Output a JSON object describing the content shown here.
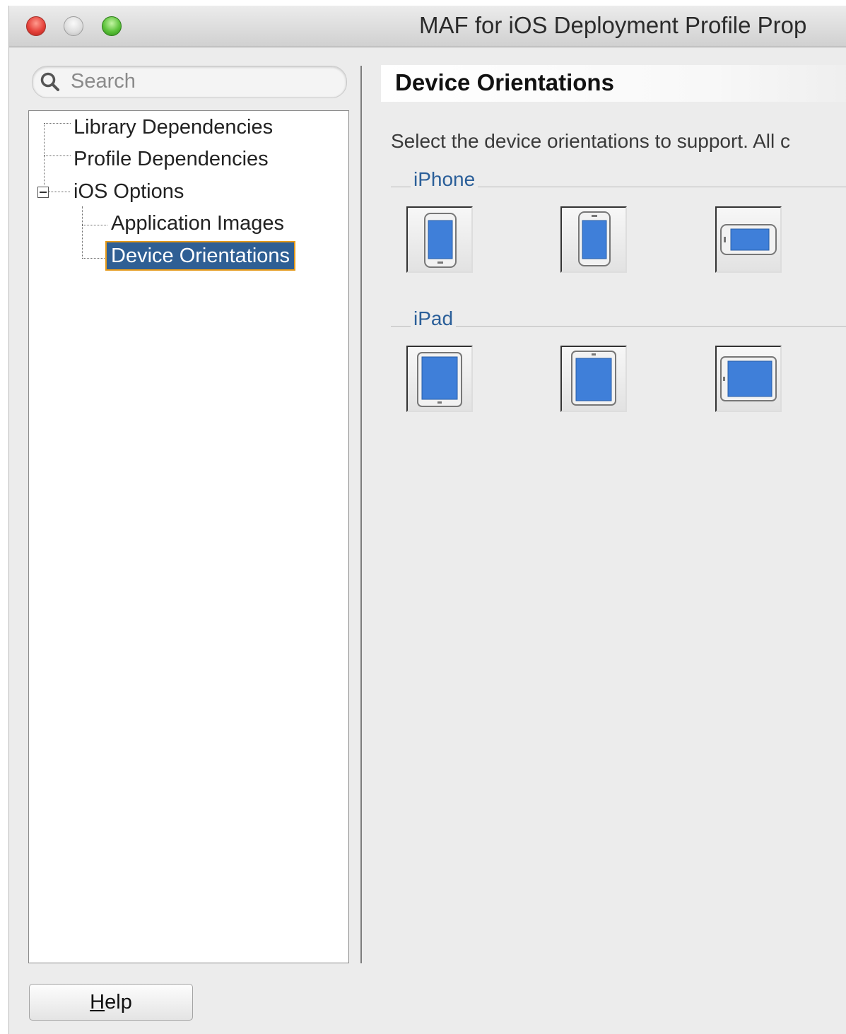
{
  "window": {
    "title": "MAF for iOS Deployment Profile Prop"
  },
  "search": {
    "placeholder": "Search"
  },
  "tree": {
    "items": [
      {
        "label": "Library Dependencies"
      },
      {
        "label": "Profile Dependencies"
      },
      {
        "label": "iOS Options"
      },
      {
        "label": "Application Images"
      },
      {
        "label": "Device Orientations"
      }
    ],
    "selected": "Device Orientations"
  },
  "main": {
    "section_title": "Device Orientations",
    "description": "Select the device orientations to support. All c",
    "groups": [
      {
        "label": "iPhone",
        "orientations": [
          "portrait",
          "portrait-upside-down",
          "landscape-left"
        ]
      },
      {
        "label": "iPad",
        "orientations": [
          "portrait",
          "portrait-upside-down",
          "landscape-left"
        ]
      }
    ]
  },
  "footer": {
    "help_mnemonic": "H",
    "help_rest": "elp"
  },
  "colors": {
    "selection_bg": "#2f5f94",
    "selection_outline": "#e59a1a",
    "group_label": "#2b5f99",
    "device_screen": "#3f7fd9"
  }
}
